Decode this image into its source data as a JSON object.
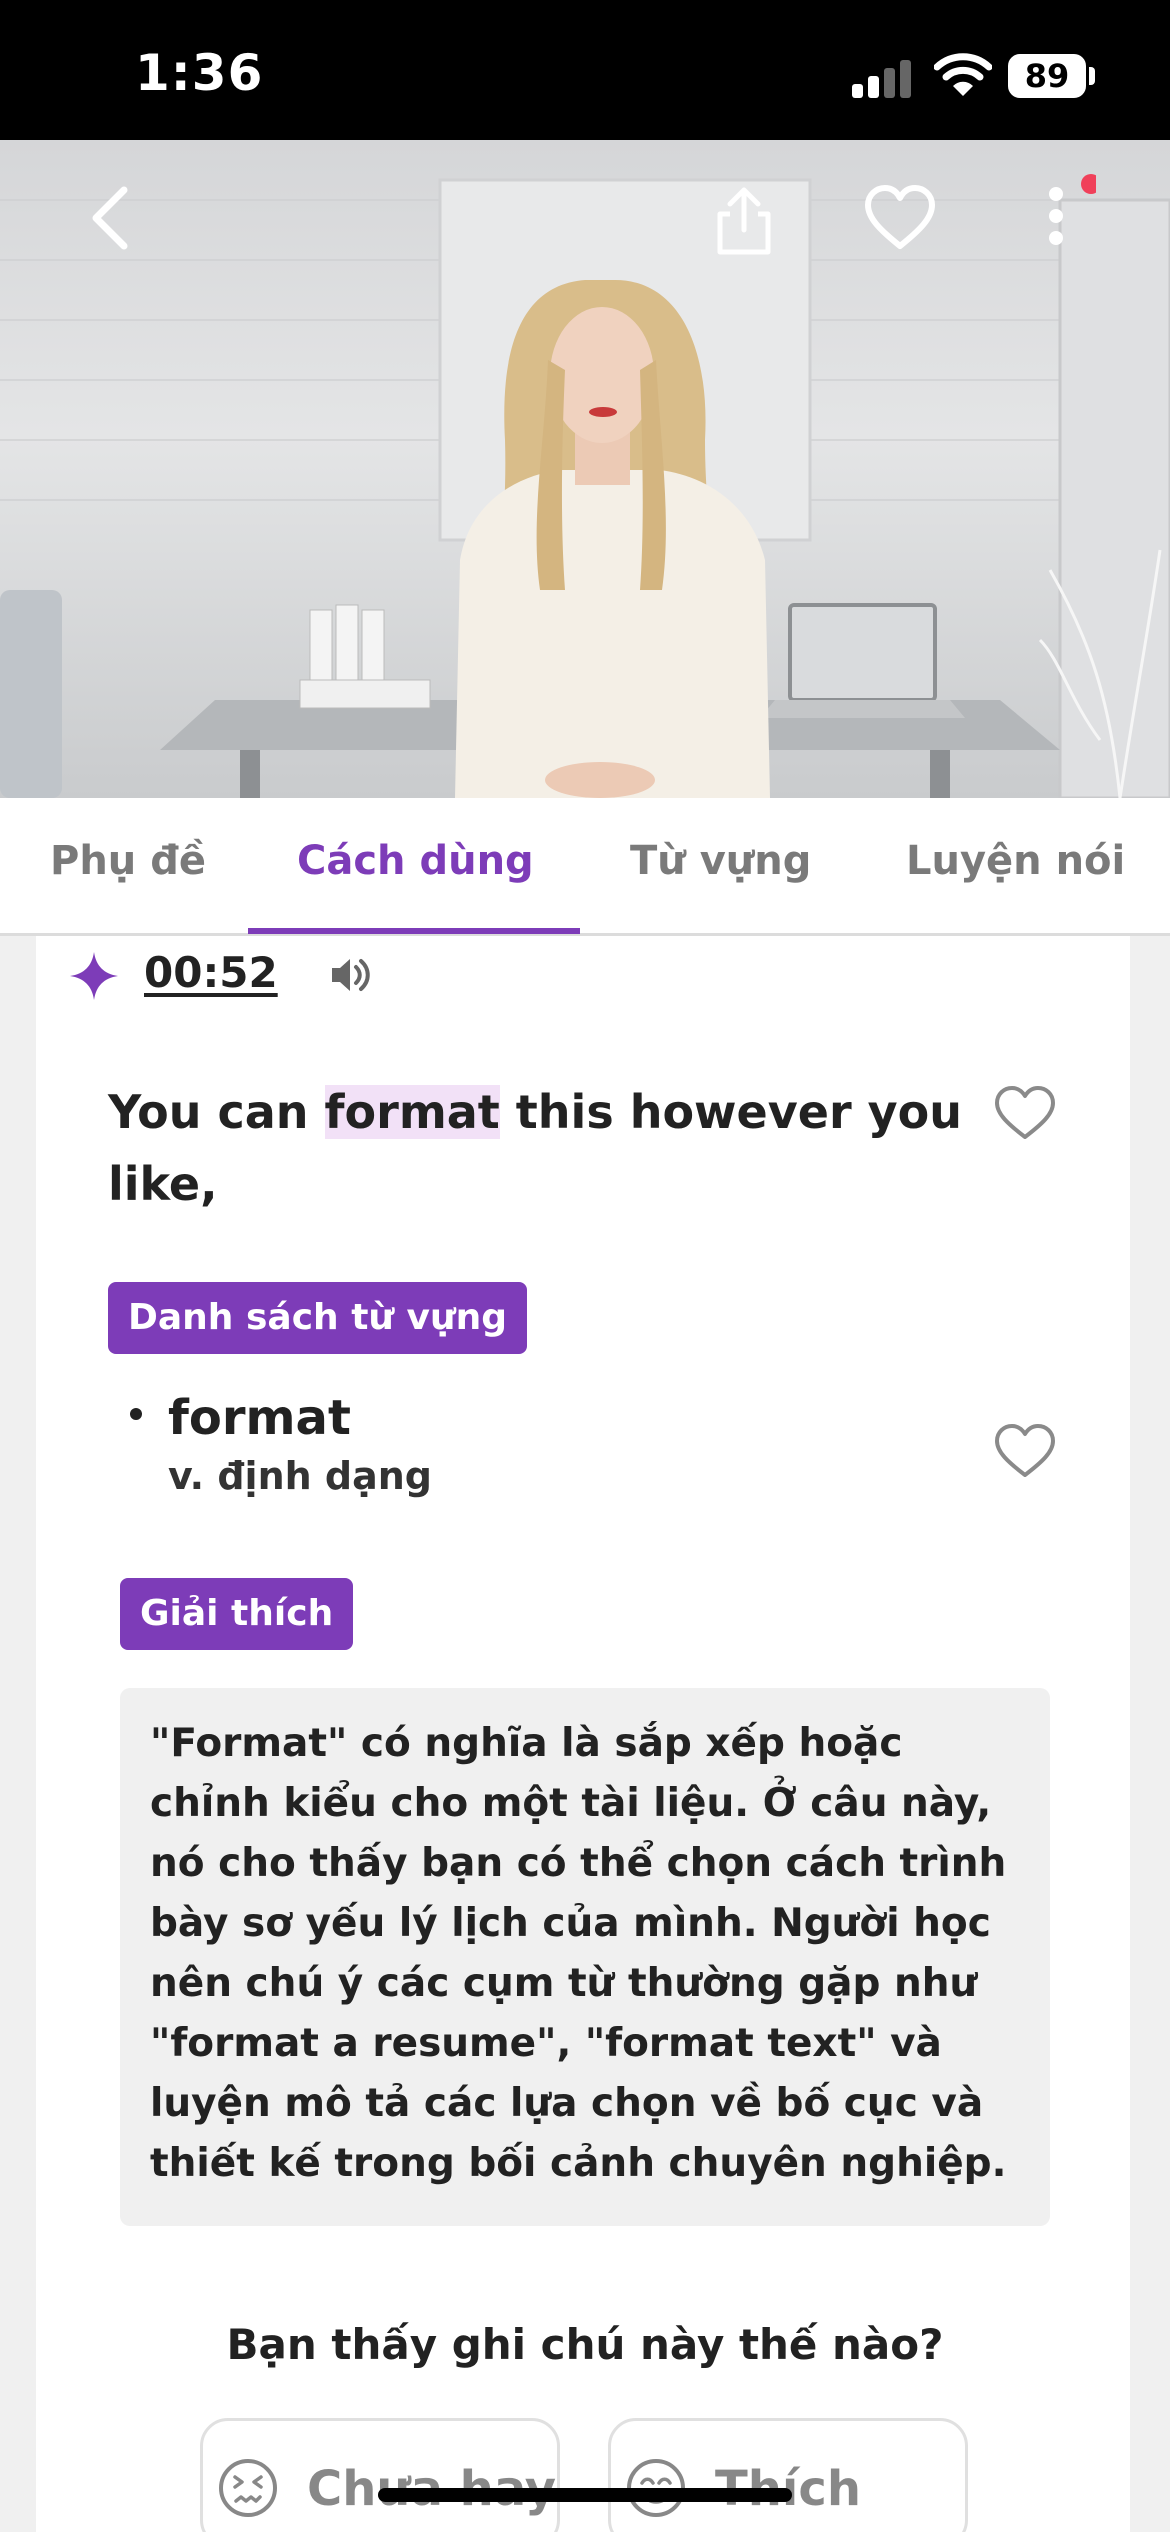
{
  "status_bar": {
    "time": "1:36",
    "battery": "89"
  },
  "tabs": [
    {
      "label": "Phụ đề"
    },
    {
      "label": "Cách dùng"
    },
    {
      "label": "Từ vựng"
    },
    {
      "label": "Luyện nói"
    }
  ],
  "active_tab": "Cách dùng",
  "timestamp": "00:52",
  "sentence": {
    "before": "You can ",
    "highlight": "format",
    "after": " this however you like,"
  },
  "vocab_section": {
    "label": "Danh sách từ vựng",
    "items": [
      {
        "word": "format",
        "definition": "v. định dạng"
      }
    ]
  },
  "explanation": {
    "label": "Giải thích",
    "text": "\"Format\" có nghĩa là sắp xếp hoặc chỉnh kiểu cho một tài liệu. Ở câu này, nó cho thấy bạn có thể chọn cách trình bày sơ yếu lý lịch của mình. Người học nên chú ý các cụm từ thường gặp như \"format a resume\", \"format text\" và luyện mô tả các lựa chọn về bố cục và thiết kế trong bối cảnh chuyên nghiệp."
  },
  "feedback": {
    "question": "Bạn thấy ghi chú này thế nào?",
    "options": [
      {
        "label": "Chưa hay"
      },
      {
        "label": "Thích"
      }
    ]
  },
  "colors": {
    "accent": "#7d3cb8",
    "notification_dot": "#f0405a",
    "highlight": "#f2e1f7"
  }
}
